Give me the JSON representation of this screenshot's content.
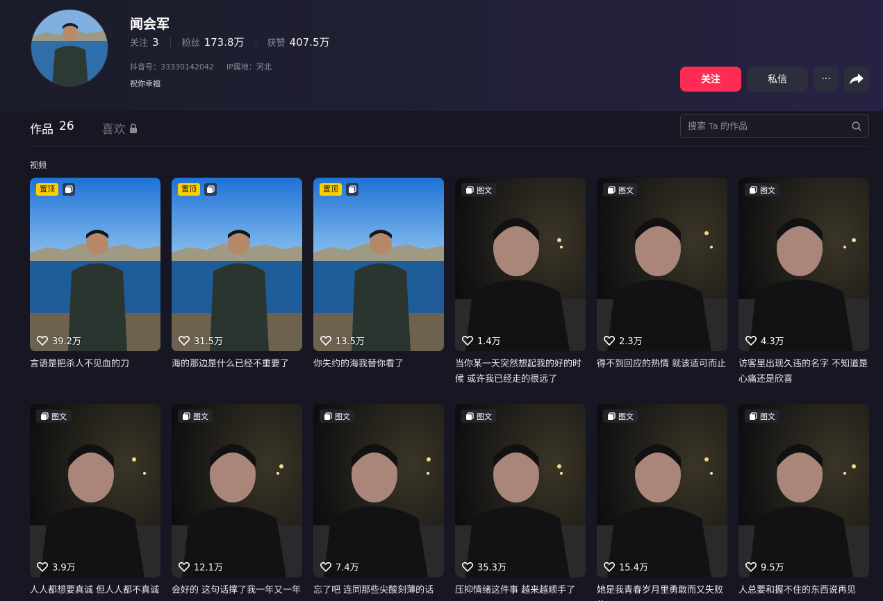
{
  "profile": {
    "name": "闻会军",
    "stats": [
      {
        "label": "关注",
        "value": "3"
      },
      {
        "label": "粉丝",
        "value": "173.8万"
      },
      {
        "label": "获赞",
        "value": "407.5万"
      }
    ],
    "douyin_id": "抖音号：33330142042",
    "ip_location": "IP属地：河北",
    "signature": "祝你幸福"
  },
  "actions": {
    "follow": "关注",
    "message": "私信",
    "more": "···"
  },
  "tabs": {
    "works_label": "作品",
    "works_count": "26",
    "likes_label": "喜欢"
  },
  "search": {
    "placeholder": "搜索 Ta 的作品"
  },
  "section_label": "视频",
  "badges": {
    "pinned": "置顶",
    "image_post": "图文"
  },
  "colors": {
    "accent": "#fe2c55",
    "pin": "#fdd000",
    "background": "#161722"
  },
  "works": [
    {
      "type": "pinned",
      "likes": "39.2万",
      "caption": "言语是把杀人不见血的刀",
      "scene": "lake"
    },
    {
      "type": "pinned",
      "likes": "31.5万",
      "caption": "海的那边是什么已经不重要了",
      "scene": "lake"
    },
    {
      "type": "pinned",
      "likes": "13.5万",
      "caption": "你失约的海我替你看了",
      "scene": "lake"
    },
    {
      "type": "image",
      "likes": "1.4万",
      "caption": "当你某一天突然想起我的好的时候 或许我已经走的很远了",
      "scene": "night"
    },
    {
      "type": "image",
      "likes": "2.3万",
      "caption": "得不到回应的热情 就该适可而止",
      "scene": "night"
    },
    {
      "type": "image",
      "likes": "4.3万",
      "caption": "访客里出现久违的名字 不知道是心痛还是欣喜",
      "scene": "night"
    },
    {
      "type": "image",
      "likes": "3.9万",
      "caption": "人人都想要真诚 但人人都不真诚",
      "scene": "night"
    },
    {
      "type": "image",
      "likes": "12.1万",
      "caption": "会好的 这句话撑了我一年又一年",
      "scene": "night"
    },
    {
      "type": "image",
      "likes": "7.4万",
      "caption": "忘了吧 连同那些尖酸刻薄的话",
      "scene": "night"
    },
    {
      "type": "image",
      "likes": "35.3万",
      "caption": "压抑情绪这件事 越来越顺手了",
      "scene": "night"
    },
    {
      "type": "image",
      "likes": "15.4万",
      "caption": "她是我青春岁月里勇敢而又失败的",
      "scene": "night"
    },
    {
      "type": "image",
      "likes": "9.5万",
      "caption": "人总要和握不住的东西说再见",
      "scene": "night"
    }
  ]
}
